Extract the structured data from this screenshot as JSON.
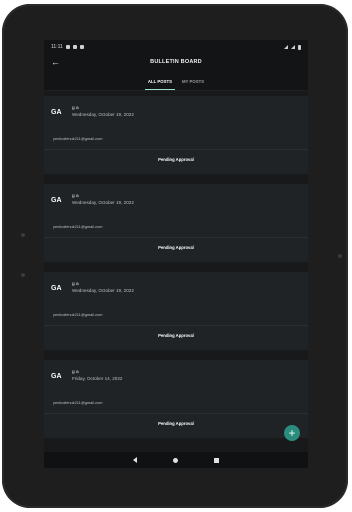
{
  "status_bar": {
    "time": "11:11"
  },
  "app_bar": {
    "back_icon": "back-arrow-icon",
    "title": "BULLETIN BOARD"
  },
  "tabs": [
    {
      "label": "ALL POSTS",
      "active": true
    },
    {
      "label": "MY POSTS",
      "active": false
    }
  ],
  "posts": [
    {
      "initials": "GA",
      "name": "g a",
      "date": "Wednesday, October 19, 2022",
      "email": "yenlicafenuk211@gmail.com",
      "status": "Pending Approval"
    },
    {
      "initials": "GA",
      "name": "g a",
      "date": "Wednesday, October 19, 2022",
      "email": "yenlicafenuk211@gmail.com",
      "status": "Pending Approval"
    },
    {
      "initials": "GA",
      "name": "g a",
      "date": "Wednesday, October 19, 2022",
      "email": "yenlicafenuk211@gmail.com",
      "status": "Pending Approval"
    },
    {
      "initials": "GA",
      "name": "g a",
      "date": "Friday, October 14, 2022",
      "email": "yenlicafenuk211@gmail.com",
      "status": "Pending Approval"
    }
  ],
  "fab": {
    "label": "+",
    "icon": "add-icon",
    "color": "#2b8c7e"
  },
  "colors": {
    "screen_bg": "#17191b",
    "card_bg": "#1f2326",
    "accent": "#9be2c8"
  }
}
